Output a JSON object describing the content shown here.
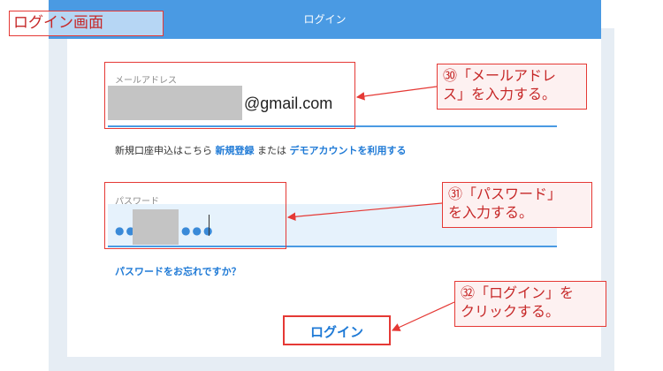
{
  "screen_label": "ログイン画面",
  "header": {
    "title": "ログイン"
  },
  "email": {
    "label": "メールアドレス",
    "domain": "@gmail.com"
  },
  "signup": {
    "prefix": "新規口座申込はこちら",
    "link_new": "新規登録",
    "middle": "または",
    "link_demo": "デモアカウントを利用する"
  },
  "password": {
    "label": "パスワード",
    "dots_left": "●●",
    "dots_right": "●●●"
  },
  "forgot_link": "パスワードをお忘れですか？",
  "login_button": "ログイン",
  "callouts": {
    "c30_line1": "㉚「メールアドレ",
    "c30_line2": "ス」を入力する。",
    "c31_line1": "㉛「パスワード」",
    "c31_line2": "を入力する。",
    "c32_line1": "㉜「ログイン」を",
    "c32_line2": "クリックする。"
  },
  "colors": {
    "header": "#4a9ae3",
    "link": "#1f7ad6",
    "annotation": "#e53935"
  }
}
